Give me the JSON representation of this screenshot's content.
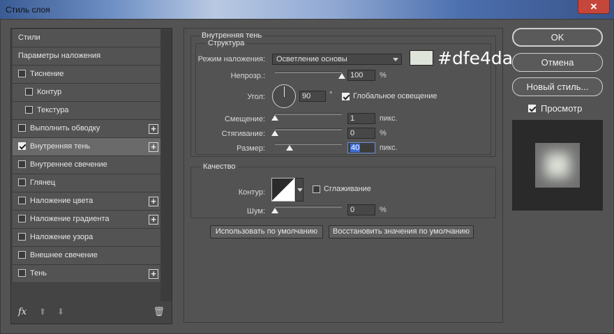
{
  "window": {
    "title": "Стиль слоя",
    "close": "✕"
  },
  "styles": [
    {
      "label": "Стили",
      "checkbox": false,
      "checked": false,
      "plus": false,
      "indent": false
    },
    {
      "label": "Параметры наложения",
      "checkbox": false,
      "checked": false,
      "plus": false,
      "indent": false
    },
    {
      "label": "Тиснение",
      "checkbox": true,
      "checked": false,
      "plus": false,
      "indent": false
    },
    {
      "label": "Контур",
      "checkbox": true,
      "checked": false,
      "plus": false,
      "indent": true
    },
    {
      "label": "Текстура",
      "checkbox": true,
      "checked": false,
      "plus": false,
      "indent": true
    },
    {
      "label": "Выполнить обводку",
      "checkbox": true,
      "checked": false,
      "plus": true,
      "indent": false
    },
    {
      "label": "Внутренняя тень",
      "checkbox": true,
      "checked": true,
      "plus": true,
      "indent": false,
      "active": true
    },
    {
      "label": "Внутреннее свечение",
      "checkbox": true,
      "checked": false,
      "plus": false,
      "indent": false
    },
    {
      "label": "Глянец",
      "checkbox": true,
      "checked": false,
      "plus": false,
      "indent": false
    },
    {
      "label": "Наложение цвета",
      "checkbox": true,
      "checked": false,
      "plus": true,
      "indent": false
    },
    {
      "label": "Наложение градиента",
      "checkbox": true,
      "checked": false,
      "plus": true,
      "indent": false
    },
    {
      "label": "Наложение узора",
      "checkbox": true,
      "checked": false,
      "plus": false,
      "indent": false
    },
    {
      "label": "Внешнее свечение",
      "checkbox": true,
      "checked": false,
      "plus": false,
      "indent": false
    },
    {
      "label": "Тень",
      "checkbox": true,
      "checked": false,
      "plus": true,
      "indent": false
    }
  ],
  "footer": {
    "fx": "fx",
    "up": "⬆",
    "down": "⬇",
    "trash": "🗑"
  },
  "inner_shadow": {
    "section_title": "Внутренняя тень",
    "structure_title": "Структура",
    "blend_label": "Режим наложения:",
    "blend_value": "Осветление основы",
    "color_hex": "#dfe4da",
    "color_caption": "#dfe4da",
    "opacity_label": "Непрозр.:",
    "opacity_value": "100",
    "opacity_unit": "%",
    "opacity_level": 1.0,
    "angle_label": "Угол:",
    "angle_value": "90",
    "angle_unit": "°",
    "global_light_label": "Глобальное освещение",
    "global_light_checked": true,
    "distance_label": "Смещение:",
    "distance_value": "1",
    "distance_unit": "пикс.",
    "choke_label": "Стягивание:",
    "choke_value": "0",
    "choke_unit": "%",
    "size_label": "Размер:",
    "size_value": "40",
    "size_unit": "пикс.",
    "quality_title": "Качество",
    "contour_label": "Контур:",
    "antialias_label": "Сглаживание",
    "antialias_checked": false,
    "noise_label": "Шум:",
    "noise_value": "0",
    "noise_unit": "%",
    "btn_default": "Использовать по умолчанию",
    "btn_reset": "Восстановить значения по умолчанию"
  },
  "right": {
    "ok": "OK",
    "cancel": "Отмена",
    "new_style": "Новый стиль...",
    "preview_label": "Просмотр",
    "preview_checked": true
  }
}
